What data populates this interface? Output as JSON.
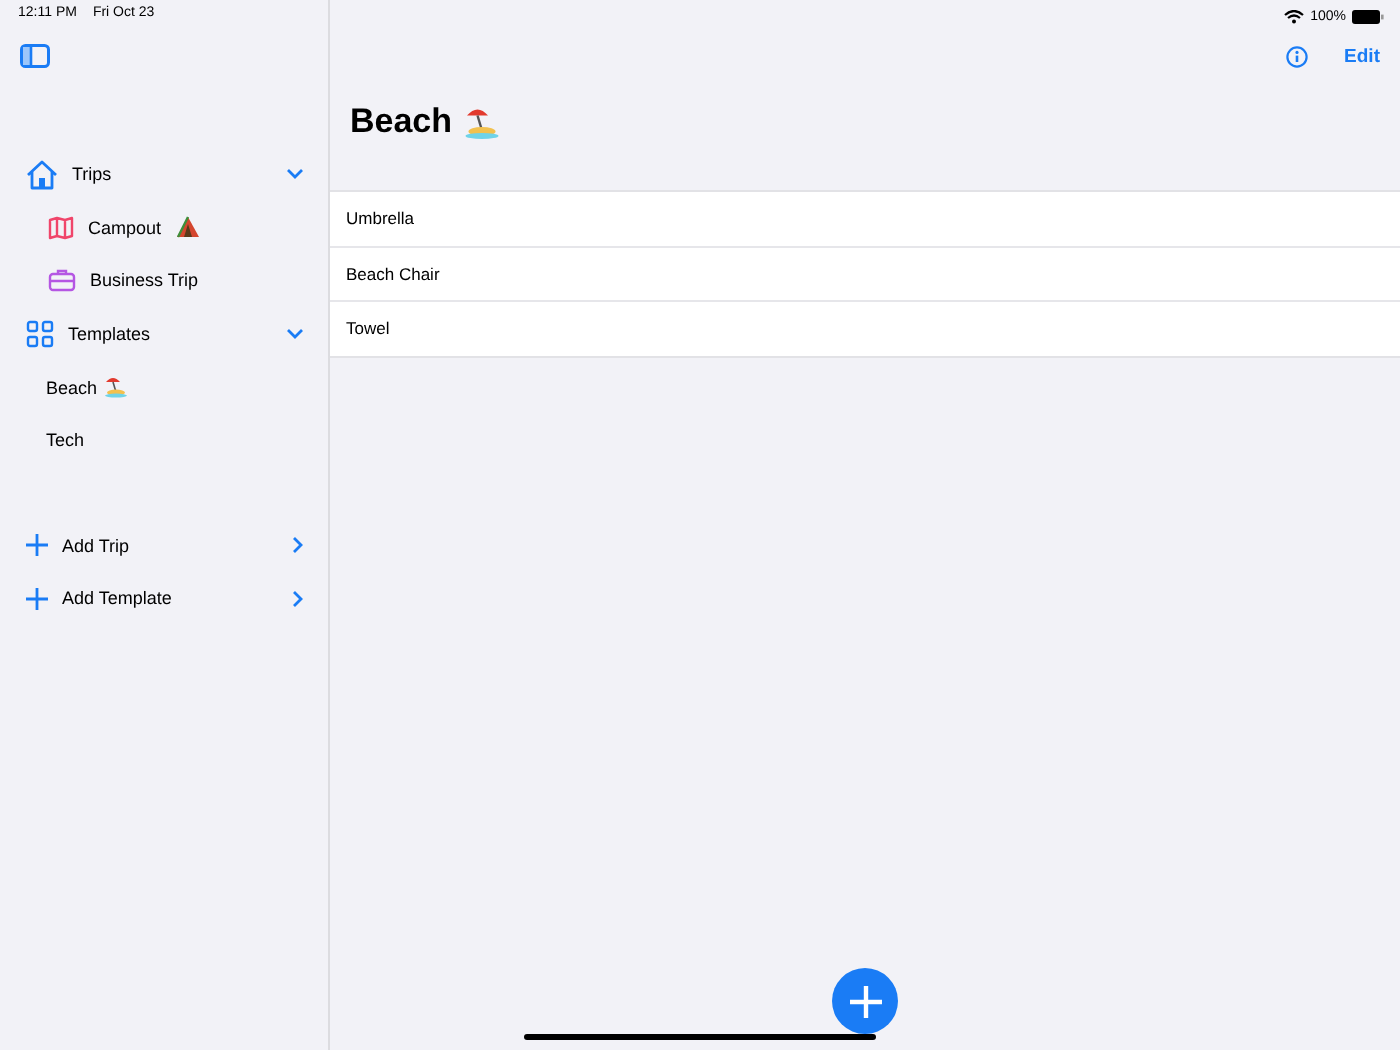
{
  "status_bar": {
    "time": "12:11 PM",
    "date": "Fri Oct 23",
    "battery": "100%"
  },
  "sidebar": {
    "sections": [
      {
        "label": "Trips",
        "expanded": true,
        "items": [
          {
            "label": "Campout"
          },
          {
            "label": "Business Trip"
          }
        ]
      },
      {
        "label": "Templates",
        "expanded": true,
        "items": [
          {
            "label": "Beach"
          },
          {
            "label": "Tech"
          }
        ]
      }
    ],
    "actions": [
      {
        "label": "Add Trip"
      },
      {
        "label": "Add Template"
      }
    ]
  },
  "toolbar": {
    "edit": "Edit"
  },
  "detail": {
    "title": "Beach",
    "items": [
      "Umbrella",
      "Beach Chair",
      "Towel"
    ]
  }
}
